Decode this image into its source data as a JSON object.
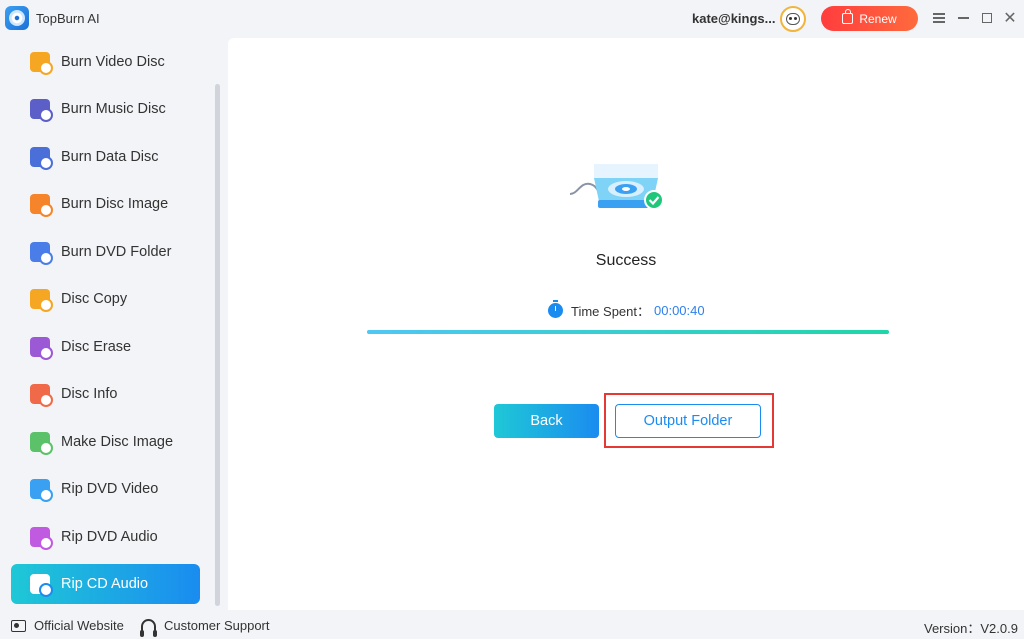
{
  "app": {
    "title": "TopBurn AI"
  },
  "header": {
    "user_email": "kate@kings...",
    "renew_label": "Renew"
  },
  "sidebar": {
    "items": [
      {
        "label": "Burn Video Disc",
        "icon": "video-disc-icon",
        "color": "#f5a623"
      },
      {
        "label": "Burn Music Disc",
        "icon": "music-disc-icon",
        "color": "#5b5fc7"
      },
      {
        "label": "Burn Data Disc",
        "icon": "data-disc-icon",
        "color": "#4a6fd8"
      },
      {
        "label": "Burn Disc Image",
        "icon": "disc-image-icon",
        "color": "#f5842a"
      },
      {
        "label": "Burn DVD Folder",
        "icon": "dvd-folder-icon",
        "color": "#4a7de8"
      },
      {
        "label": "Disc Copy",
        "icon": "disc-copy-icon",
        "color": "#f5a623"
      },
      {
        "label": "Disc Erase",
        "icon": "disc-erase-icon",
        "color": "#9b59d6"
      },
      {
        "label": "Disc Info",
        "icon": "disc-info-icon",
        "color": "#f06a4a"
      },
      {
        "label": "Make Disc Image",
        "icon": "make-disc-image-icon",
        "color": "#5cc26a"
      },
      {
        "label": "Rip DVD Video",
        "icon": "rip-dvd-video-icon",
        "color": "#3aa0f2"
      },
      {
        "label": "Rip DVD Audio",
        "icon": "rip-dvd-audio-icon",
        "color": "#c05ae0"
      },
      {
        "label": "Rip CD Audio",
        "icon": "rip-cd-audio-icon",
        "color": "#ffffff",
        "active": true
      }
    ]
  },
  "main": {
    "status_title": "Success",
    "time_label": "Time Spent：",
    "time_value": "00:00:40",
    "progress": 1.0,
    "back_label": "Back",
    "output_label": "Output Folder"
  },
  "footer": {
    "website_label": "Official Website",
    "support_label": "Customer Support",
    "version": "Version：V2.0.9"
  },
  "colors": {
    "accent": "#1a8cf0",
    "accent_start": "#1fc8d6",
    "renew": "#ff4a3d",
    "highlight": "#e53935",
    "success": "#1fc77a"
  }
}
